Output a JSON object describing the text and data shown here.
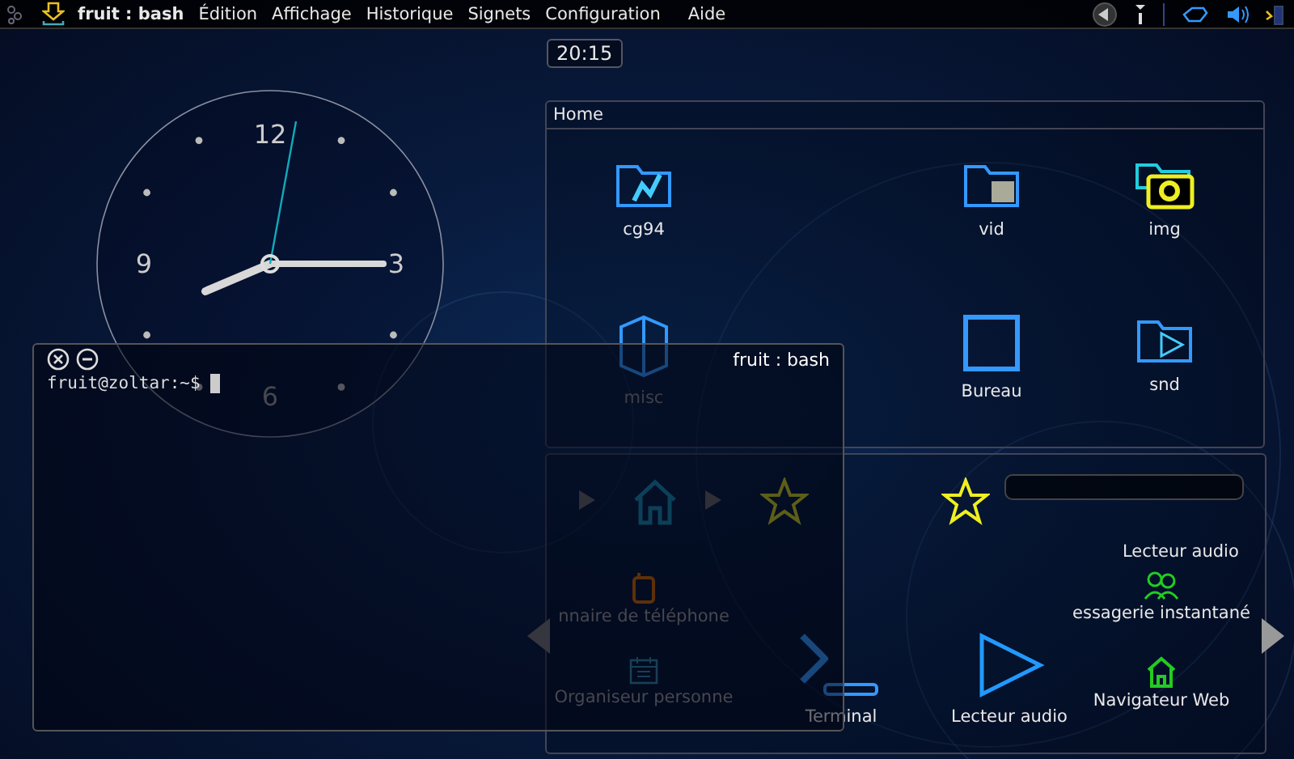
{
  "menubar": {
    "title": "fruit : bash",
    "items": [
      "Édition",
      "Affichage",
      "Historique",
      "Signets",
      "Configuration",
      "Aide"
    ]
  },
  "digital_clock": {
    "time": "20:15"
  },
  "analog_clock": {
    "numerals": [
      "12",
      "3",
      "6",
      "9"
    ]
  },
  "folder_view": {
    "title": "Home",
    "items": [
      {
        "label": "cg94",
        "kind": "folder-chart"
      },
      {
        "label": "vid",
        "kind": "folder-video"
      },
      {
        "label": "img",
        "kind": "folder-image"
      },
      {
        "label": "misc",
        "kind": "box"
      },
      {
        "label": "Bureau",
        "kind": "frame"
      },
      {
        "label": "snd",
        "kind": "folder-audio"
      }
    ]
  },
  "terminal": {
    "title": "fruit : bash",
    "prompt": "fruit@zoltar:~$"
  },
  "launcher": {
    "labels": [
      "Lecteur audio"
    ],
    "items": [
      {
        "label": "nnaire de téléphone",
        "kind": "phone"
      },
      {
        "label": "Organiseur personne",
        "kind": "calendar"
      },
      {
        "label": "Terminal",
        "kind": "terminal"
      },
      {
        "label": "Lecteur audio",
        "kind": "play"
      },
      {
        "label": "essagerie instantané",
        "kind": "chat"
      },
      {
        "label": "Navigateur Web",
        "kind": "web"
      }
    ]
  }
}
